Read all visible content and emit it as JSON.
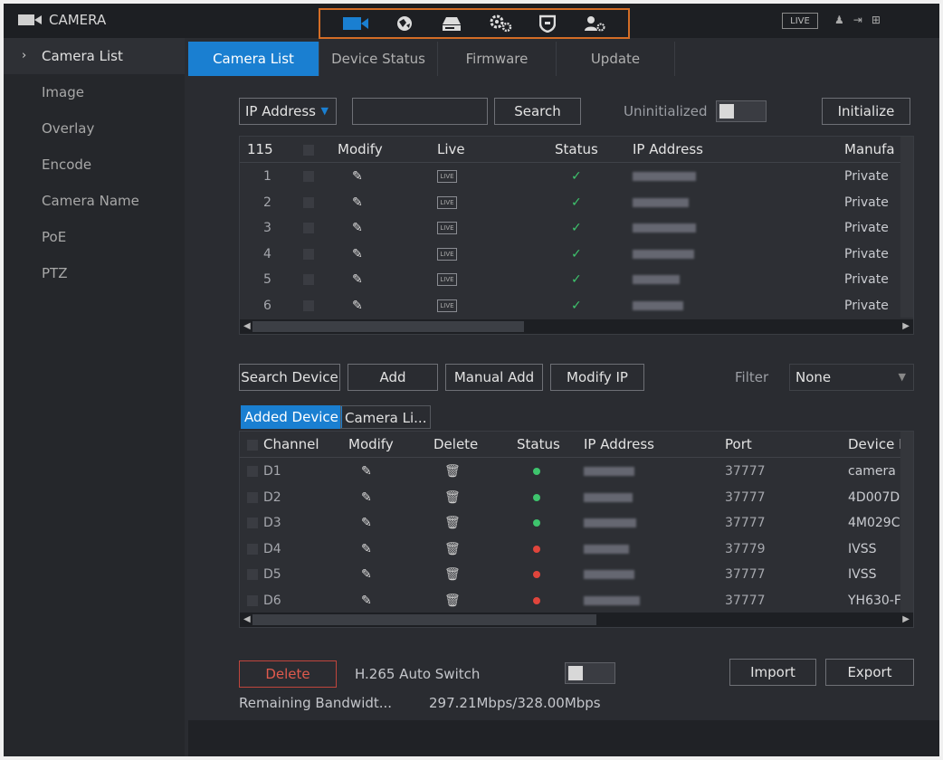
{
  "app": {
    "title": "CAMERA",
    "live_badge": "LIVE",
    "top_icons": [
      "user-icon",
      "logout-icon",
      "grid-icon"
    ]
  },
  "module_bar": {
    "icons": [
      "camera-icon",
      "network-icon",
      "storage-icon",
      "system-settings-icon",
      "security-shield-icon",
      "account-icon"
    ]
  },
  "sidebar": {
    "items": [
      {
        "label": "Camera List",
        "active": true
      },
      {
        "label": "Image"
      },
      {
        "label": "Overlay"
      },
      {
        "label": "Encode"
      },
      {
        "label": "Camera Name"
      },
      {
        "label": "PoE"
      },
      {
        "label": "PTZ"
      }
    ]
  },
  "tabs": [
    {
      "label": "Camera List",
      "active": true
    },
    {
      "label": "Device Status"
    },
    {
      "label": "Firmware"
    },
    {
      "label": "Update"
    }
  ],
  "search_bar": {
    "filter_type": "IP Address",
    "search_value": "",
    "search_label": "Search",
    "uninitialized_label": "Uninitialized",
    "initialize_label": "Initialize"
  },
  "search_table": {
    "count": "115",
    "headers": [
      "Modify",
      "Live",
      "Status",
      "IP Address",
      "Manufa"
    ],
    "rows": [
      {
        "no": "1",
        "manufacturer": "Private"
      },
      {
        "no": "2",
        "manufacturer": "Private"
      },
      {
        "no": "3",
        "manufacturer": "Private"
      },
      {
        "no": "4",
        "manufacturer": "Private"
      },
      {
        "no": "5",
        "manufacturer": "Private"
      },
      {
        "no": "6",
        "manufacturer": "Private"
      }
    ],
    "live_icon_text": "LIVE"
  },
  "actions": {
    "search_device": "Search Device",
    "add": "Add",
    "manual_add": "Manual Add",
    "modify_ip": "Modify IP",
    "filter_label": "Filter",
    "filter_value": "None"
  },
  "subtabs": [
    {
      "label": "Added Device",
      "active": true
    },
    {
      "label": "Camera Li..."
    }
  ],
  "added_table": {
    "headers": [
      "Channel",
      "Modify",
      "Delete",
      "Status",
      "IP Address",
      "Port",
      "Device N"
    ],
    "rows": [
      {
        "channel": "D1",
        "status": "online",
        "port": "37777",
        "device": "camera"
      },
      {
        "channel": "D2",
        "status": "online",
        "port": "37777",
        "device": "4D007D"
      },
      {
        "channel": "D3",
        "status": "online",
        "port": "37777",
        "device": "4M029C"
      },
      {
        "channel": "D4",
        "status": "offline",
        "port": "37779",
        "device": "IVSS"
      },
      {
        "channel": "D5",
        "status": "offline",
        "port": "37777",
        "device": "IVSS"
      },
      {
        "channel": "D6",
        "status": "offline",
        "port": "37777",
        "device": "YH630-F"
      }
    ]
  },
  "footer": {
    "delete": "Delete",
    "h265_label": "H.265 Auto Switch",
    "import": "Import",
    "export": "Export",
    "bandwidth_label": "Remaining Bandwidt...",
    "bandwidth_value": "297.21Mbps/328.00Mbps"
  },
  "colors": {
    "accent": "#1a7fd1",
    "online": "#3ec46d",
    "offline": "#e0453c",
    "module_border": "#d46d26",
    "delete_text": "#e05a4d"
  }
}
